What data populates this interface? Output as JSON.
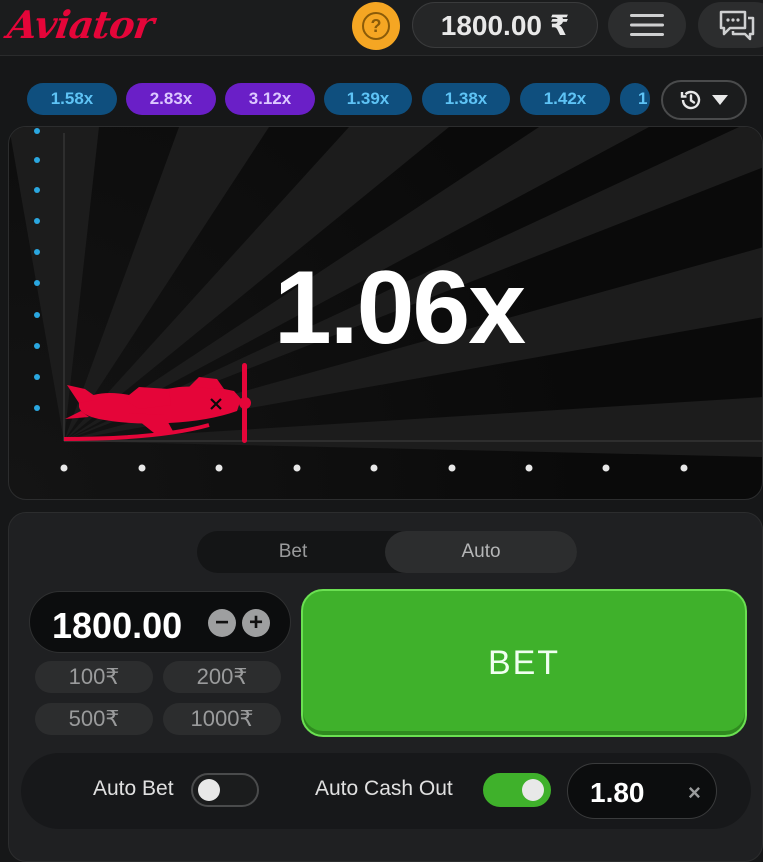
{
  "header": {
    "logo": "Aviator",
    "help_icon": "question-icon",
    "balance": "1800.00 ₹",
    "menu_icon": "hamburger-icon",
    "chat_icon": "chat-icon"
  },
  "history": {
    "multipliers": [
      {
        "label": "1.58x",
        "color": "#0f4f7e"
      },
      {
        "label": "2.83x",
        "color": "#6a1fc7"
      },
      {
        "label": "3.12x",
        "color": "#6a1fc7"
      },
      {
        "label": "1.39x",
        "color": "#0f4f7e"
      },
      {
        "label": "1.38x",
        "color": "#0f4f7e"
      },
      {
        "label": "1.42x",
        "color": "#0f4f7e"
      },
      {
        "label": "1",
        "color": "#0f4f7e"
      }
    ],
    "history_icon": "clock-history-icon",
    "dropdown_icon": "chevron-down-icon"
  },
  "game": {
    "multiplier": "1.06x",
    "plane_color": "#e50539"
  },
  "bet_panel": {
    "tabs": {
      "bet": "Bet",
      "auto": "Auto",
      "active": "auto"
    },
    "stake": "1800.00",
    "minus_label": "−",
    "plus_label": "+",
    "quick_amounts": [
      "100₹",
      "200₹",
      "500₹",
      "1000₹"
    ],
    "bet_button": "BET",
    "bet_color": "#3fb12b",
    "auto_bet_label": "Auto Bet",
    "auto_bet_on": false,
    "auto_cashout_label": "Auto Cash Out",
    "auto_cashout_on": true,
    "cashout_value": "1.80",
    "clear_label": "×"
  }
}
